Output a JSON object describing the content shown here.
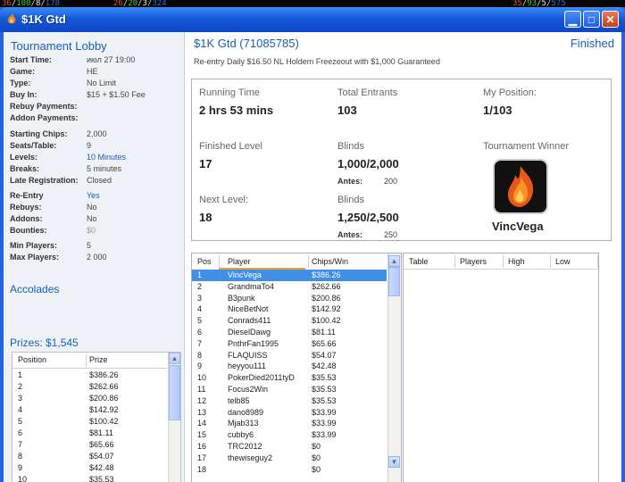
{
  "topstrip": {
    "left": [
      {
        "text": "36",
        "color": "#e34a3a"
      },
      {
        "text": "/",
        "color": "#cccccc"
      },
      {
        "text": "100",
        "color": "#49c341"
      },
      {
        "text": "/",
        "color": "#cccccc"
      },
      {
        "text": "8",
        "color": "#e8e8e8"
      },
      {
        "text": "/",
        "color": "#cccccc"
      },
      {
        "text": "178",
        "color": "#2f6bd9"
      }
    ],
    "mid": [
      {
        "text": "26",
        "color": "#e34a3a"
      },
      {
        "text": "/",
        "color": "#cccccc"
      },
      {
        "text": "20",
        "color": "#49c341"
      },
      {
        "text": "/",
        "color": "#cccccc"
      },
      {
        "text": "3",
        "color": "#e8e8e8"
      },
      {
        "text": "/",
        "color": "#cccccc"
      },
      {
        "text": "324",
        "color": "#2f6bd9"
      }
    ],
    "right": [
      {
        "text": "35",
        "color": "#e34a3a"
      },
      {
        "text": "/",
        "color": "#cccccc"
      },
      {
        "text": "93",
        "color": "#49c341"
      },
      {
        "text": "/",
        "color": "#cccccc"
      },
      {
        "text": "5",
        "color": "#e8e8e8"
      },
      {
        "text": "/",
        "color": "#cccccc"
      },
      {
        "text": "575",
        "color": "#2f6bd9"
      }
    ]
  },
  "window": {
    "title": "$1K Gtd",
    "minimize_icon": "minimize-icon",
    "maximize_icon": "maximize-icon",
    "close_icon": "close-icon"
  },
  "lobby": {
    "title": "Tournament Lobby",
    "info": [
      {
        "k": "Start Time:",
        "v": "июл 27 19:00",
        "style": ""
      },
      {
        "k": "Game:",
        "v": "HE",
        "style": ""
      },
      {
        "k": "Type:",
        "v": "No Limit",
        "style": ""
      },
      {
        "k": "Buy In:",
        "v": "$15 + $1.50 Fee",
        "style": ""
      },
      {
        "k": "Rebuy Payments:",
        "v": "",
        "style": ""
      },
      {
        "k": "Addon Payments:",
        "v": "",
        "style": ""
      },
      {
        "k": "Starting Chips:",
        "v": "2,000",
        "style": ""
      },
      {
        "k": "Seats/Table:",
        "v": "9",
        "style": ""
      },
      {
        "k": "Levels:",
        "v": "10 Minutes",
        "style": "blue"
      },
      {
        "k": "Breaks:",
        "v": "5 minutes",
        "style": ""
      },
      {
        "k": "Late Registration:",
        "v": "Closed",
        "style": ""
      },
      {
        "k": "Re-Entry",
        "v": "Yes",
        "style": "blue"
      },
      {
        "k": "Rebuys:",
        "v": "No",
        "style": ""
      },
      {
        "k": "Addons:",
        "v": "No",
        "style": ""
      },
      {
        "k": "Bounties:",
        "v": "$0",
        "style": "grey"
      },
      {
        "k": "Min Players:",
        "v": "5",
        "style": ""
      },
      {
        "k": "Max Players:",
        "v": "2 000",
        "style": ""
      }
    ],
    "accolades": "Accolades",
    "prizes_label": "Prizes: $1,545",
    "prize_headers": {
      "position": "Position",
      "prize": "Prize"
    },
    "prizes": [
      {
        "pos": "1",
        "prize": "$386.26"
      },
      {
        "pos": "2",
        "prize": "$262.66"
      },
      {
        "pos": "3",
        "prize": "$200.86"
      },
      {
        "pos": "4",
        "prize": "$142.92"
      },
      {
        "pos": "5",
        "prize": "$100.42"
      },
      {
        "pos": "6",
        "prize": "$81.11"
      },
      {
        "pos": "7",
        "prize": "$65.66"
      },
      {
        "pos": "8",
        "prize": "$54.07"
      },
      {
        "pos": "9",
        "prize": "$42.48"
      },
      {
        "pos": "10",
        "prize": "$35.53"
      }
    ]
  },
  "tournament": {
    "name": "$1K Gtd (71085785)",
    "status": "Finished",
    "description": "Re-entry Daily $16.50 NL Holdem Freezeout with $1,000 Guaranteed",
    "running_time_label": "Running Time",
    "running_time": "2 hrs 53 mins",
    "entrants_label": "Total Entrants",
    "entrants": "103",
    "position_label": "My Position:",
    "position": "1/103",
    "finished_level_label": "Finished Level",
    "finished_level": "17",
    "blinds_label": "Blinds",
    "blinds": "1,000/2,000",
    "antes_label": "Antes:",
    "antes": "200",
    "winner_label": "Tournament Winner",
    "winner": "VincVega",
    "next_level_label": "Next Level:",
    "next_level": "18",
    "next_blinds_label": "Blinds",
    "next_blinds": "1,250/2,500",
    "next_antes_label": "Antes:",
    "next_antes": "250"
  },
  "players": {
    "headers": {
      "pos": "Pos",
      "player": "Player",
      "chips": "Chips/Win"
    },
    "rows": [
      {
        "pos": "1",
        "player": "VincVega",
        "chips": "$386.26"
      },
      {
        "pos": "2",
        "player": "GrandmaTo4",
        "chips": "$262.66"
      },
      {
        "pos": "3",
        "player": "B3punk",
        "chips": "$200.86"
      },
      {
        "pos": "4",
        "player": "NiceBetNot",
        "chips": "$142.92"
      },
      {
        "pos": "5",
        "player": "Conrads411",
        "chips": "$100.42"
      },
      {
        "pos": "6",
        "player": "DieselDawg",
        "chips": "$81.11"
      },
      {
        "pos": "7",
        "player": "PnthrFan1995",
        "chips": "$65.66"
      },
      {
        "pos": "8",
        "player": "FLAQUISS",
        "chips": "$54.07"
      },
      {
        "pos": "9",
        "player": "heyyou111",
        "chips": "$42.48"
      },
      {
        "pos": "10",
        "player": "PokerDied2011tyD",
        "chips": "$35.53"
      },
      {
        "pos": "11",
        "player": "Focus2Win",
        "chips": "$35.53"
      },
      {
        "pos": "12",
        "player": "telb85",
        "chips": "$35.53"
      },
      {
        "pos": "13",
        "player": "dano8989",
        "chips": "$33.99"
      },
      {
        "pos": "14",
        "player": "Mjab313",
        "chips": "$33.99"
      },
      {
        "pos": "15",
        "player": "cubby6",
        "chips": "$33.99"
      },
      {
        "pos": "16",
        "player": "TRC2012",
        "chips": "$0"
      },
      {
        "pos": "17",
        "player": "thewiseguy2",
        "chips": "$0"
      },
      {
        "pos": "18",
        "player": "",
        "chips": "$0"
      }
    ]
  },
  "tables": {
    "headers": {
      "table": "Table",
      "players": "Players",
      "high": "High",
      "low": "Low"
    }
  }
}
